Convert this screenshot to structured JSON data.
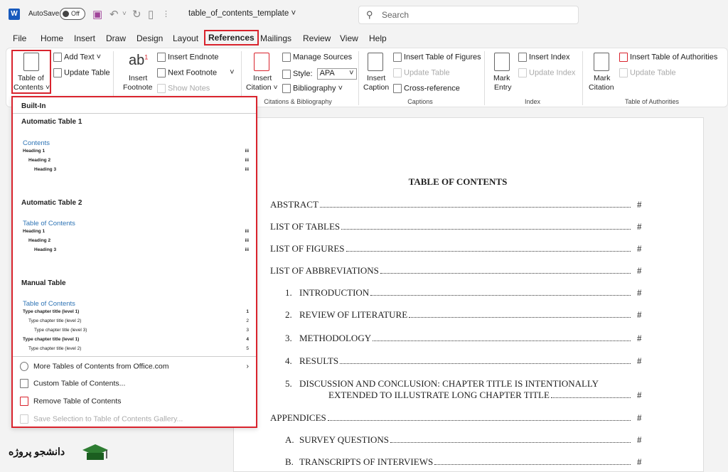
{
  "titlebar": {
    "logo_letter": "W",
    "autosave_label": "AutoSave",
    "autosave_state": "Off",
    "filename": "table_of_contents_template",
    "search_placeholder": "Search"
  },
  "menu": [
    "File",
    "Home",
    "Insert",
    "Draw",
    "Design",
    "Layout",
    "References",
    "Mailings",
    "Review",
    "View",
    "Help"
  ],
  "menu_active": "References",
  "ribbon": {
    "toc_label_1": "Table of",
    "toc_label_2": "Contents ˅",
    "add_text": "Add Text ˅",
    "update_table": "Update Table",
    "insert_footnote_1": "Insert",
    "insert_footnote_2": "Footnote",
    "footnote_glyph": "ab",
    "footnote_sup": "1",
    "insert_endnote": "Insert Endnote",
    "next_footnote": "Next Footnote",
    "show_notes": "Show Notes",
    "insert_citation_1": "Insert",
    "insert_citation_2": "Citation ˅",
    "manage_sources": "Manage Sources",
    "style_label": "Style:",
    "style_value": "APA",
    "bibliography": "Bibliography ˅",
    "group_citations": "Citations & Bibliography",
    "insert_caption_1": "Insert",
    "insert_caption_2": "Caption",
    "insert_tof": "Insert Table of Figures",
    "update_table_cap": "Update Table",
    "cross_reference": "Cross-reference",
    "group_captions": "Captions",
    "mark_entry_1": "Mark",
    "mark_entry_2": "Entry",
    "insert_index": "Insert Index",
    "update_index": "Update Index",
    "group_index": "Index",
    "mark_citation_1": "Mark",
    "mark_citation_2": "Citation",
    "insert_toa": "Insert Table of Authorities",
    "update_table_toa": "Update Table",
    "group_toa": "Table of Authorities"
  },
  "dropdown": {
    "section": "Built-In",
    "auto1": {
      "heading": "Automatic Table 1",
      "title": "Contents",
      "lines": [
        "Heading 1",
        "Heading 2",
        "Heading 3"
      ],
      "page": "iii"
    },
    "auto2": {
      "heading": "Automatic Table 2",
      "title": "Table of Contents",
      "lines": [
        "Heading 1",
        "Heading 2",
        "Heading 3"
      ],
      "page": "iii"
    },
    "manual": {
      "heading": "Manual Table",
      "title": "Table of Contents",
      "lines": [
        "Type chapter title (level 1)",
        "Type chapter title (level 2)",
        "Type chapter title (level 3)",
        "Type chapter title (level 1)",
        "Type chapter title (level 2)"
      ],
      "pages": [
        "1",
        "2",
        "3",
        "4",
        "5"
      ]
    },
    "more": "More Tables of Contents from Office.com",
    "custom": "Custom Table of Contents...",
    "remove": "Remove Table of Contents",
    "save": "Save Selection to Table of Contents Gallery..."
  },
  "document": {
    "title": "TABLE OF CONTENTS",
    "entries": [
      {
        "num": "",
        "text": "ABSTRACT",
        "page": "#"
      },
      {
        "num": "",
        "text": "LIST OF TABLES",
        "page": "#"
      },
      {
        "num": "",
        "text": "LIST OF FIGURES",
        "page": "#"
      },
      {
        "num": "",
        "text": "LIST OF ABBREVIATIONS",
        "page": "#"
      },
      {
        "num": "1.",
        "text": "INTRODUCTION",
        "page": "#"
      },
      {
        "num": "2.",
        "text": "REVIEW OF LITERATURE",
        "page": "#"
      },
      {
        "num": "3.",
        "text": "METHODOLOGY",
        "page": "#"
      },
      {
        "num": "4.",
        "text": "RESULTS",
        "page": "#"
      },
      {
        "num": "5.",
        "text": "DISCUSSION AND CONCLUSION: CHAPTER TITLE IS INTENTIONALLY",
        "page": ""
      },
      {
        "num": "",
        "text": "EXTENDED TO ILLUSTRATE LONG CHAPTER TITLE",
        "page": "#"
      },
      {
        "num": "",
        "text": "APPENDICES",
        "page": "#"
      },
      {
        "num": "A.",
        "text": "SURVEY QUESTIONS",
        "page": "#"
      },
      {
        "num": "B.",
        "text": "TRANSCRIPTS OF INTERVIEWS",
        "page": "#"
      }
    ]
  },
  "watermark": {
    "text": "دانشجو پروژه"
  },
  "colors": {
    "accent_red": "#d9232d",
    "word_blue": "#185abd",
    "heading_blue": "#2e74b5"
  }
}
